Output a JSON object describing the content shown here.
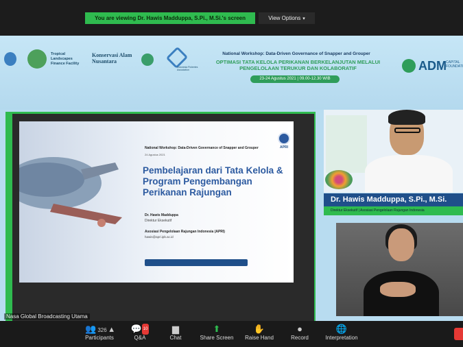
{
  "topbar": {
    "viewing_text": "You are viewing Dr. Hawis Madduppa, S.Pi., M.Si.'s screen",
    "view_options_label": "View Options",
    "colors": {
      "viewing_bg": "#2fbb4f"
    }
  },
  "banner": {
    "logo1": "Tropical Landscapes Finance Facility",
    "logo2": "Konservasi Alam Nusantara",
    "logo3": "Indonesia Fisheries Association",
    "workshop_title": "National Workshop: Data-Driven Governance of Snapper and Grouper",
    "workshop_main": "OPTIMASI TATA KELOLA PERIKANAN BERKELANJUTAN MELALUI PENGELOLAAN TERUKUR DAN KOLABORATIF",
    "workshop_date": "23-24 Agustus 2021 | 09.00-12.30 WIB",
    "adm_logo": "ADM",
    "adm_sub": "CAPITAL FOUNDATION"
  },
  "slide": {
    "workshop": "National Workshop: Data-Driven Governance of Snapper and Grouper",
    "date": "24 Agustus 2021",
    "title": "Pembelajaran dari Tata Kelola & Program Pengembangan Perikanan Rajungan",
    "presenter_name": "Dr. Hawis Madduppa",
    "presenter_role": "Direktur Eksekutif",
    "org": "Asosiasi Pengelolaan Rajungan Indonesia (APRI)",
    "email": "hawis@apri.ipb.ac.id",
    "apri_logo": "APRI"
  },
  "speaker": {
    "name": "Dr. Hawis Madduppa, S.Pi., M.Si.",
    "role": "Direktur Eksekutif | Asosiasi Pengelolaan Rajungan Indonesia"
  },
  "nasa_label": "Nasa Global Broadcasting Utama",
  "toolbar": {
    "participants_label": "Participants",
    "participants_count": "326",
    "qa_label": "Q&A",
    "qa_badge": "10",
    "chat_label": "Chat",
    "share_label": "Share Screen",
    "raise_label": "Raise Hand",
    "record_label": "Record",
    "interp_label": "Interpretation",
    "icons": [
      "participants-icon",
      "qa-icon",
      "chat-icon",
      "share-screen-icon",
      "raise-hand-icon",
      "record-icon",
      "globe-icon"
    ]
  }
}
